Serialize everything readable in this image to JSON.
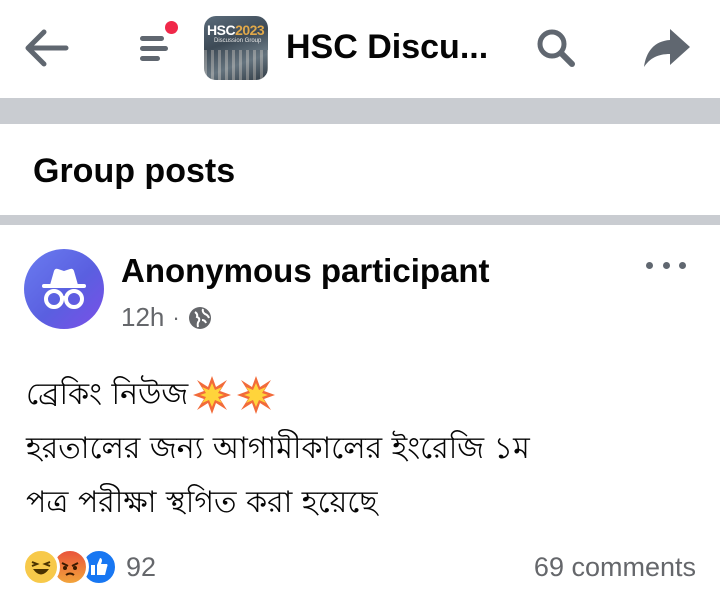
{
  "header": {
    "group_name": "HSC Discu...",
    "thumbnail": {
      "title_prefix": "HSC",
      "title_year": "2023",
      "subtitle": "Discussion Group"
    },
    "icons": {
      "back": "arrow-left-icon",
      "menu": "hamburger-menu-icon",
      "search": "search-icon",
      "share": "share-arrow-icon"
    },
    "notification_dot_color": "#f02849"
  },
  "section": {
    "title": "Group posts"
  },
  "post": {
    "author": "Anonymous participant",
    "time": "12h",
    "separator": "·",
    "privacy_icon": "globe-icon",
    "more_icon": "more-options-icon",
    "body_lines": [
      "ব্রেকিং নিউজ",
      "হরতালের জন্য আগামীকালের ইংরেজি ১ম",
      "পত্র পরীক্ষা স্থগিত করা হয়েছে"
    ],
    "body_emoji": "collision-icon",
    "reaction_icons": [
      "haha-reaction-icon",
      "angry-reaction-icon",
      "like-reaction-icon"
    ],
    "reaction_count": "92",
    "comments": "69 comments"
  },
  "colors": {
    "accent": "#1877f2",
    "divider": "#c9ccd1",
    "secondary_text": "#65676b",
    "avatar": "#6a6ef0"
  }
}
